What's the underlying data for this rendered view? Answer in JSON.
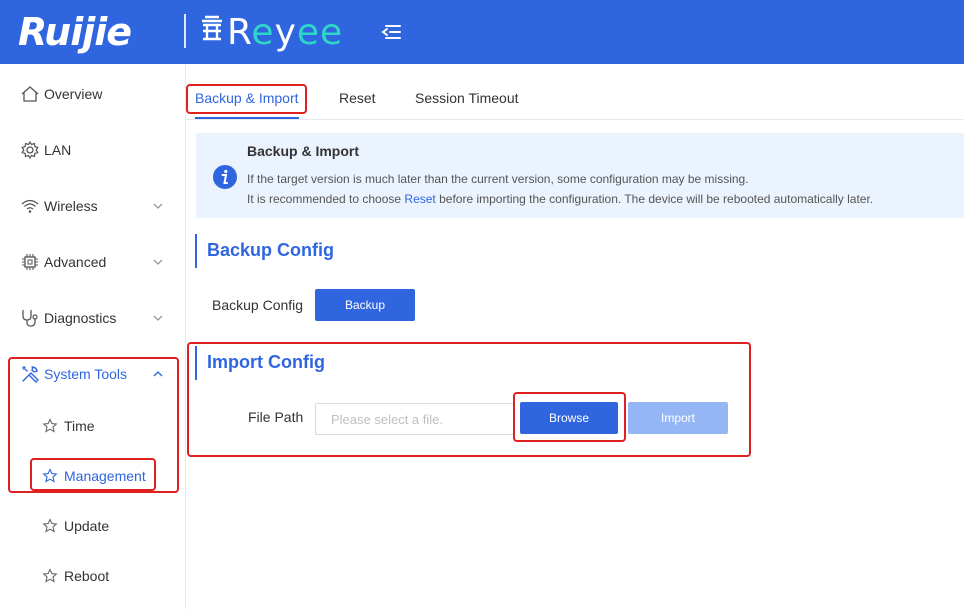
{
  "header": {
    "brand": "Ruijie",
    "product": "Reyee",
    "product_mark": "⛩"
  },
  "sidebar": {
    "items": [
      {
        "label": "Overview",
        "icon": "home-icon"
      },
      {
        "label": "LAN",
        "icon": "gear-icon"
      },
      {
        "label": "Wireless",
        "icon": "wifi-icon"
      },
      {
        "label": "Advanced",
        "icon": "chip-icon"
      },
      {
        "label": "Diagnostics",
        "icon": "stethoscope-icon"
      },
      {
        "label": "System Tools",
        "icon": "tools-icon"
      }
    ],
    "subitems": [
      {
        "label": "Time",
        "icon": "star-icon"
      },
      {
        "label": "Management",
        "icon": "star-icon"
      },
      {
        "label": "Update",
        "icon": "star-icon"
      },
      {
        "label": "Reboot",
        "icon": "star-icon"
      }
    ]
  },
  "tabs": [
    "Backup & Import",
    "Reset",
    "Session Timeout"
  ],
  "alert": {
    "title": "Backup & Import",
    "line1": "If the target version is much later than the current version, some configuration may be missing.",
    "line2_prefix": "It is recommended to choose ",
    "line2_link": "Reset",
    "line2_suffix": " before importing the configuration. The device will be rebooted automatically later."
  },
  "backup": {
    "section_title": "Backup Config",
    "field_label": "Backup Config",
    "button_label": "Backup"
  },
  "import": {
    "section_title": "Import Config",
    "field_label": "File Path",
    "file_placeholder": "Please select a file.",
    "browse_label": "Browse",
    "import_label": "Import"
  },
  "colors": {
    "primary": "#2f66e0",
    "accent": "#2fd6c8",
    "highlight": "#e02020",
    "alert_bg": "#ebf3fe"
  }
}
